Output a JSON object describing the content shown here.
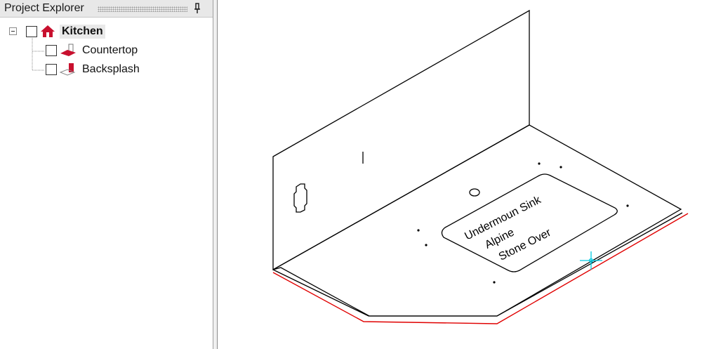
{
  "panel": {
    "title": "Project Explorer",
    "pin_icon": "pin-icon"
  },
  "tree": {
    "root": {
      "label": "Kitchen",
      "icon": "house-icon",
      "expanded": true,
      "checked": false
    },
    "children": [
      {
        "label": "Countertop",
        "icon": "countertop-icon",
        "checked": false
      },
      {
        "label": "Backsplash",
        "icon": "backsplash-icon",
        "checked": false
      }
    ]
  },
  "drawing": {
    "sink_cutout_label_lines": [
      "Undermoun Sink",
      "Alpine",
      "Stone Over"
    ],
    "colors": {
      "outline": "#000000",
      "finished_edge": "#e00000",
      "cursor": "#00c8e0",
      "house_icon": "#c8102e"
    }
  }
}
